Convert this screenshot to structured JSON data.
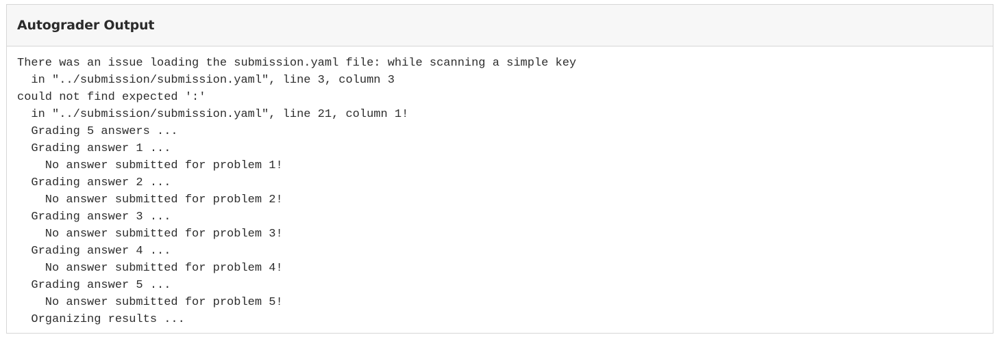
{
  "panel": {
    "title": "Autograder Output",
    "lines": [
      "There was an issue loading the submission.yaml file: while scanning a simple key",
      "  in \"../submission/submission.yaml\", line 3, column 3",
      "could not find expected ':'",
      "  in \"../submission/submission.yaml\", line 21, column 1!",
      "  Grading 5 answers ...",
      "  Grading answer 1 ...",
      "    No answer submitted for problem 1!",
      "  Grading answer 2 ...",
      "    No answer submitted for problem 2!",
      "  Grading answer 3 ...",
      "    No answer submitted for problem 3!",
      "  Grading answer 4 ...",
      "    No answer submitted for problem 4!",
      "  Grading answer 5 ...",
      "    No answer submitted for problem 5!",
      "  Organizing results ..."
    ]
  }
}
